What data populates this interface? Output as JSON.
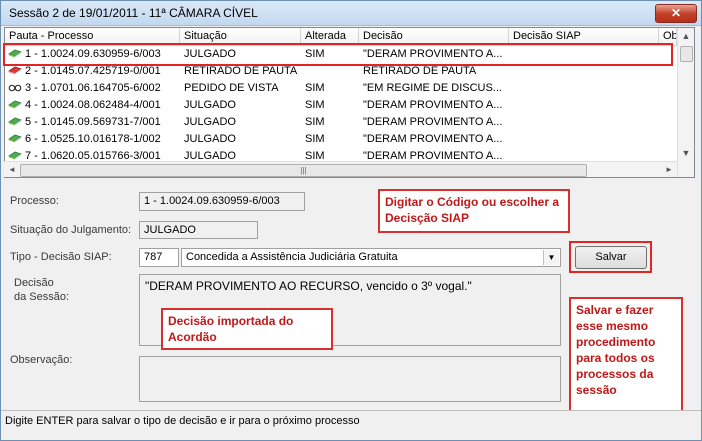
{
  "window": {
    "title": "Sessão 2 de 19/01/2011 - 11ª CÂMARA CÍVEL",
    "close_label": "✕"
  },
  "grid": {
    "columns": [
      "Pauta - Processo",
      "Situação",
      "Alterada",
      "Decisão",
      "Decisão SIAP",
      "Ob"
    ],
    "rows": [
      {
        "processo": "1 - 1.0024.09.630959-6/003",
        "situacao": "JULGADO",
        "alterada": "SIM",
        "decisao": "\"DERAM PROVIMENTO A...",
        "icon": "green-book-icon"
      },
      {
        "processo": "2 - 1.0145.07.425719-0/001",
        "situacao": "RETIRADO DE PAUTA",
        "alterada": "",
        "decisao": "RETIRADO DE PAUTA",
        "icon": "red-book-icon"
      },
      {
        "processo": "3 - 1.0701.06.164705-6/002",
        "situacao": "PEDIDO DE VISTA",
        "alterada": "SIM",
        "decisao": "\"EM REGIME DE DISCUS...",
        "icon": "glasses-icon"
      },
      {
        "processo": "4 - 1.0024.08.062484-4/001",
        "situacao": "JULGADO",
        "alterada": "SIM",
        "decisao": "\"DERAM PROVIMENTO A...",
        "icon": "green-book-icon"
      },
      {
        "processo": "5 - 1.0145.09.569731-7/001",
        "situacao": "JULGADO",
        "alterada": "SIM",
        "decisao": "\"DERAM PROVIMENTO A...",
        "icon": "green-book-icon"
      },
      {
        "processo": "6 - 1.0525.10.016178-1/002",
        "situacao": "JULGADO",
        "alterada": "SIM",
        "decisao": "\"DERAM PROVIMENTO A...",
        "icon": "green-book-icon"
      },
      {
        "processo": "7 - 1.0620.05.015766-3/001",
        "situacao": "JULGADO",
        "alterada": "SIM",
        "decisao": "\"DERAM PROVIMENTO A...",
        "icon": "green-book-icon"
      }
    ]
  },
  "form": {
    "processo_label": "Processo:",
    "processo_value": "1 - 1.0024.09.630959-6/003",
    "situacao_label": "Situação do Julgamento:",
    "situacao_value": "JULGADO",
    "tipo_label": "Tipo - Decisão SIAP:",
    "tipo_code": "787",
    "tipo_value": "Concedida a Assistência Judiciária Gratuita",
    "salvar_label": "Salvar",
    "decisao_label_1": "Decisão",
    "decisao_label_2": "da Sessão:",
    "decisao_value": "\"DERAM PROVIMENTO AO RECURSO, vencido o 3º vogal.\"",
    "observacao_label": "Observação:",
    "observacao_value": ""
  },
  "annotations": {
    "codigo": "Digitar o Código ou escolher a Decisção SIAP",
    "importada": "Decisão importada do Acordão",
    "salvar": "Salvar e fazer esse mesmo procedimento para todos os processos da sessão"
  },
  "status": "Digite ENTER para salvar o tipo de decisão e ir para o próximo processo"
}
